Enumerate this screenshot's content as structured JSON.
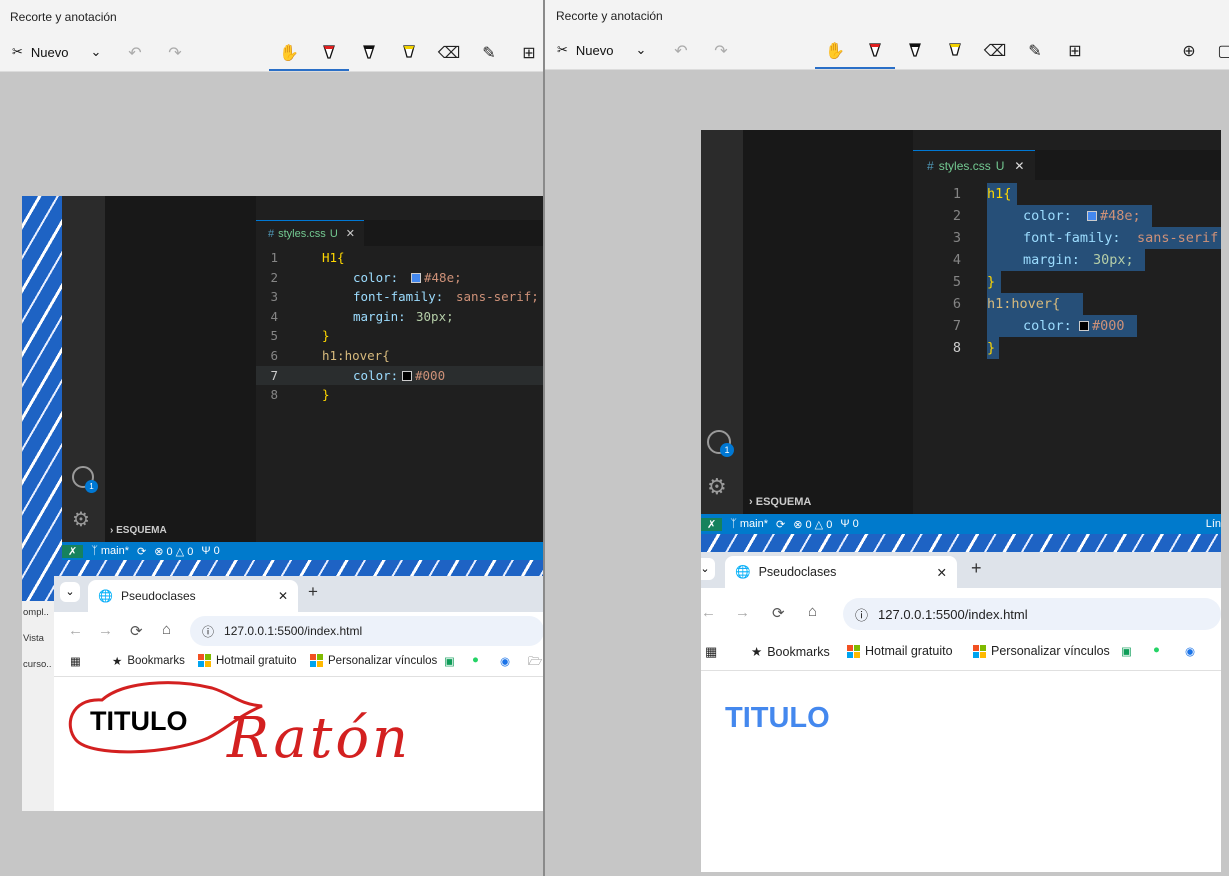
{
  "left_window": {
    "title": "Recorte y anotación",
    "new_label": "Nuevo",
    "code_tab": "styles.css",
    "code_tab_badge": "U",
    "code_lines": [
      {
        "n": "1",
        "t": "H1{"
      },
      {
        "n": "2",
        "t": "color:",
        "val": "#48e;"
      },
      {
        "n": "3",
        "t": "font-family:",
        "val": "sans-serif;"
      },
      {
        "n": "4",
        "t": "margin:",
        "val": "30px;"
      },
      {
        "n": "5",
        "t": "}"
      },
      {
        "n": "6",
        "t": "h1:hover{"
      },
      {
        "n": "7",
        "t": "color:",
        "val": "#000"
      },
      {
        "n": "8",
        "t": "}"
      }
    ],
    "outline": "ESQUEMA",
    "status_branch": "main*",
    "status_errors": "0",
    "status_warnings": "0",
    "status_ports": "0",
    "account_badge": "1",
    "browser_tab": "Pseudoclases",
    "url": "127.0.0.1:5500/index.html",
    "bookmarks": [
      "Bookmarks",
      "Hotmail gratuito",
      "Personalizar vínculos"
    ],
    "page_heading": "TITULO",
    "handwriting": "Ratón",
    "side_fragments": [
      "ompl..",
      "Vista",
      "curso.."
    ]
  },
  "right_window": {
    "title": "Recorte y anotación",
    "new_label": "Nuevo",
    "code_tab": "styles.css",
    "code_tab_badge": "U",
    "code_lines": [
      {
        "n": "1",
        "t": "h1{"
      },
      {
        "n": "2",
        "t": "color:",
        "val": "#48e;"
      },
      {
        "n": "3",
        "t": "font-family:",
        "val": "sans-serif"
      },
      {
        "n": "4",
        "t": "margin:",
        "val": "30px;"
      },
      {
        "n": "5",
        "t": "}"
      },
      {
        "n": "6",
        "t": "h1:hover{"
      },
      {
        "n": "7",
        "t": "color:",
        "val": "#000"
      },
      {
        "n": "8",
        "t": "}"
      }
    ],
    "outline": "ESQUEMA",
    "status_branch": "main*",
    "status_errors": "0",
    "status_warnings": "0",
    "status_ports": "0",
    "status_right": "Lín",
    "account_badge": "1",
    "browser_tab": "Pseudoclases",
    "url": "127.0.0.1:5500/index.html",
    "bookmarks": [
      "Bookmarks",
      "Hotmail gratuito",
      "Personalizar vínculos"
    ],
    "page_heading": "TITULO"
  },
  "colors": {
    "heading_blue": "#4488ee",
    "vscode_bg": "#1e1e1e",
    "status_blue": "#007acc",
    "pen_red": "#d32020",
    "selection": "#264f78"
  }
}
